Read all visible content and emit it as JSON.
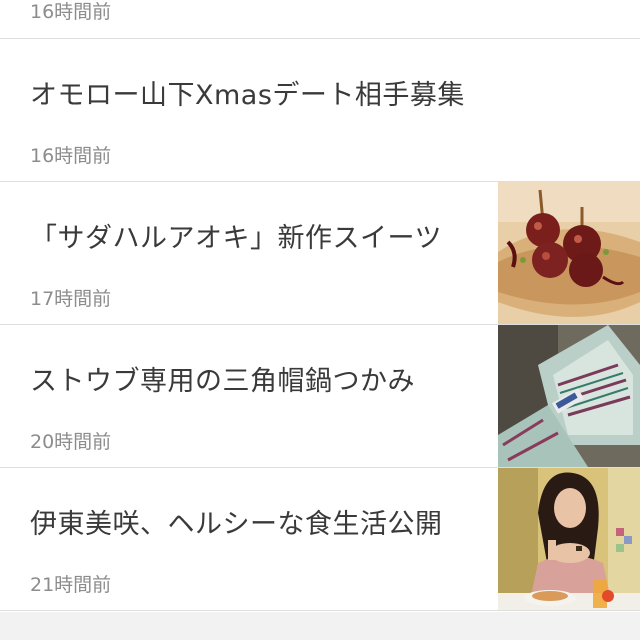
{
  "top_item": {
    "time": "16時間前"
  },
  "items": [
    {
      "title": "オモロー山下Xmasデート相手募集",
      "time": "16時間前",
      "thumbnail": null
    },
    {
      "title": "「サダハルアオキ」新作スイーツ",
      "time": "17時間前",
      "thumbnail": "sweets-image"
    },
    {
      "title": "ストウブ専用の三角帽鍋つかみ",
      "time": "20時間前",
      "thumbnail": "pot-holder-image"
    },
    {
      "title": "伊東美咲、ヘルシーな食生活公開",
      "time": "21時間前",
      "thumbnail": "woman-photo-image"
    }
  ]
}
